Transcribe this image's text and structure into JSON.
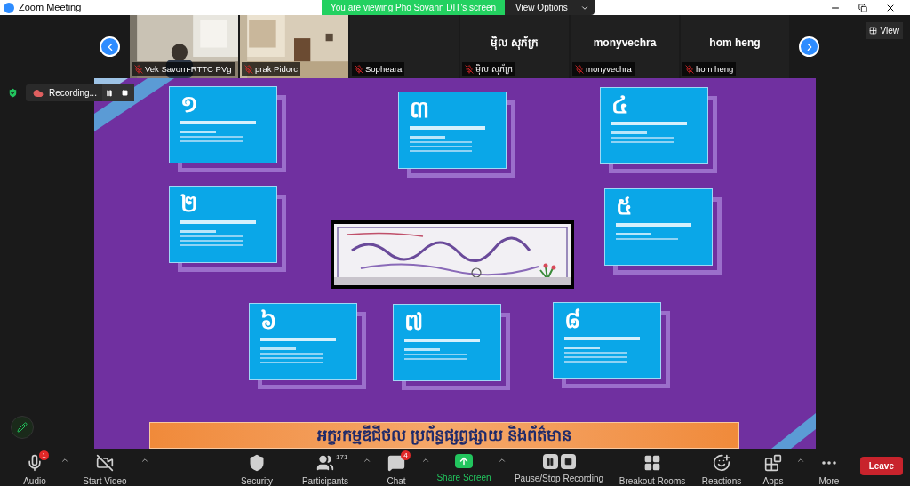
{
  "window": {
    "title": "Zoom Meeting"
  },
  "share_banner": {
    "text": "You are viewing Pho Sovann DIT's screen",
    "button": "View Options"
  },
  "view_button": "View",
  "participants": [
    {
      "kind": "video",
      "name": "Vek Savorn-RTTC PVg",
      "muted": true
    },
    {
      "kind": "video",
      "name": "prak Pidorc",
      "muted": true
    },
    {
      "kind": "blank",
      "name": "Sopheara",
      "muted": true
    },
    {
      "kind": "name",
      "display": "ម៉ិល សុភ័ក្រ",
      "name": "ម៉ិល សុភ័ក្រ",
      "muted": true
    },
    {
      "kind": "name",
      "display": "monyvechra",
      "name": "monyvechra",
      "muted": true
    },
    {
      "kind": "name",
      "display": "hom heng",
      "name": "hom heng",
      "muted": true
    }
  ],
  "recording": {
    "label": "Recording..."
  },
  "slide": {
    "cards": [
      {
        "number": "១"
      },
      {
        "number": "២"
      },
      {
        "number": "៣"
      },
      {
        "number": "៤"
      },
      {
        "number": "៥"
      },
      {
        "number": "៦"
      },
      {
        "number": "៧"
      },
      {
        "number": "៨"
      }
    ],
    "banner": "អក្ខរកម្មឌីជីថល ប្រព័ន្ធផ្សព្វផ្សាយ និងព័ត៌មាន"
  },
  "toolbar": [
    {
      "kind": "audio",
      "label": "Audio",
      "badge": "1",
      "caret": true
    },
    {
      "kind": "video",
      "label": "Start Video",
      "caret": true
    },
    {
      "kind": "security",
      "label": "Security",
      "caret": false
    },
    {
      "kind": "participants",
      "label": "Participants",
      "count": "171",
      "caret": true
    },
    {
      "kind": "chat",
      "label": "Chat",
      "badge": "4",
      "caret": true
    },
    {
      "kind": "share",
      "label": "Share Screen",
      "caret": true
    },
    {
      "kind": "record",
      "label": "Pause/Stop Recording",
      "caret": false
    },
    {
      "kind": "breakout",
      "label": "Breakout Rooms",
      "caret": false
    },
    {
      "kind": "reactions",
      "label": "Reactions",
      "caret": false
    },
    {
      "kind": "apps",
      "label": "Apps",
      "caret": true
    },
    {
      "kind": "more",
      "label": "More",
      "caret": false
    }
  ],
  "leave_button": "Leave"
}
